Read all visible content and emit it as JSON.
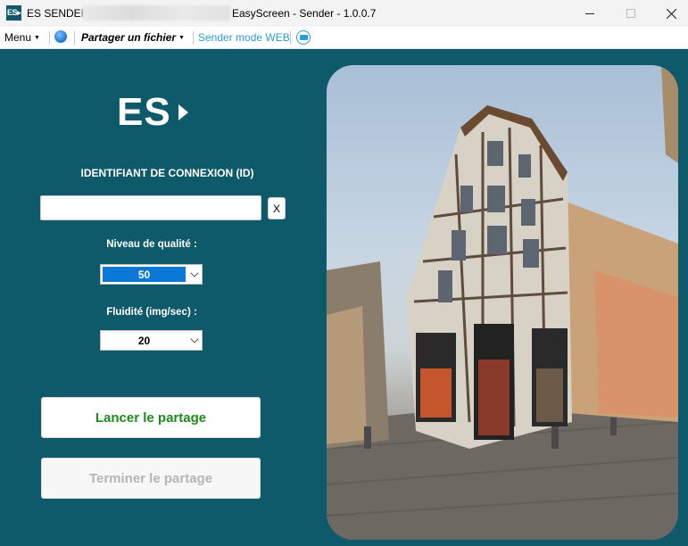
{
  "titlebar": {
    "app_icon_text": "ES▸",
    "app_name": "ES SENDER",
    "window_title": "EasyScreen - Sender - 1.0.0.7"
  },
  "menubar": {
    "menu_label": "Menu",
    "share_label": "Partager un fichier",
    "web_label": "Sender mode WEB"
  },
  "main": {
    "logo_text": "ES",
    "id_label": "IDENTIFIANT DE CONNEXION (ID)",
    "id_value": "",
    "clear_label": "X",
    "quality_label": "Niveau de qualité :",
    "quality_value": "50",
    "fluidity_label": "Fluidité (img/sec) :",
    "fluidity_value": "20",
    "start_label": "Lancer le partage",
    "stop_label": "Terminer le partage"
  },
  "icons": [
    "globe-icon",
    "mail-icon",
    "chevron-down-icon",
    "minimize-icon",
    "maximize-icon",
    "close-icon"
  ],
  "colors": {
    "background": "#0f5a6a",
    "accent": "#0a78d7",
    "start_text": "#1e8a1e",
    "disabled_text": "#b5b5b5",
    "link": "#2a9fd6"
  }
}
